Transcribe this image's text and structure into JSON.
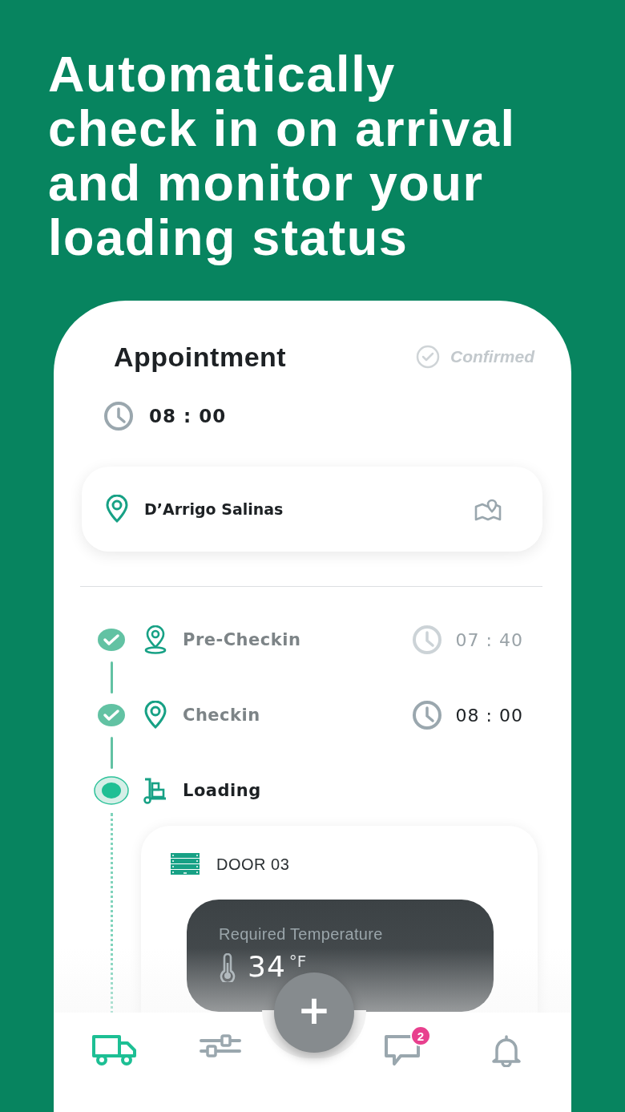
{
  "headline": "Automatically\ncheck in on arrival\nand monitor your\nloading status",
  "appointment": {
    "title": "Appointment",
    "status": "Confirmed",
    "time": "08 : 00"
  },
  "location": {
    "name": "D’Arrigo Salinas"
  },
  "steps": [
    {
      "kind": "pre-checkin",
      "label": "Pre-Checkin",
      "done": true,
      "current": false,
      "time": "07 : 40",
      "time_muted": true
    },
    {
      "kind": "checkin",
      "label": "Checkin",
      "done": true,
      "current": false,
      "time": "08 : 00",
      "time_muted": false
    },
    {
      "kind": "loading",
      "label": "Loading",
      "done": false,
      "current": true
    }
  ],
  "door": {
    "label": "DOOR 03",
    "temperature_label": "Required Temperature",
    "temperature": "34",
    "unit": "°F"
  },
  "fab": {
    "label": "+"
  },
  "nav": [
    {
      "kind": "truck",
      "selected": true
    },
    {
      "kind": "sliders",
      "selected": false
    },
    {
      "kind": "chat",
      "selected": false,
      "badge": "2"
    },
    {
      "kind": "bell",
      "selected": false
    }
  ]
}
